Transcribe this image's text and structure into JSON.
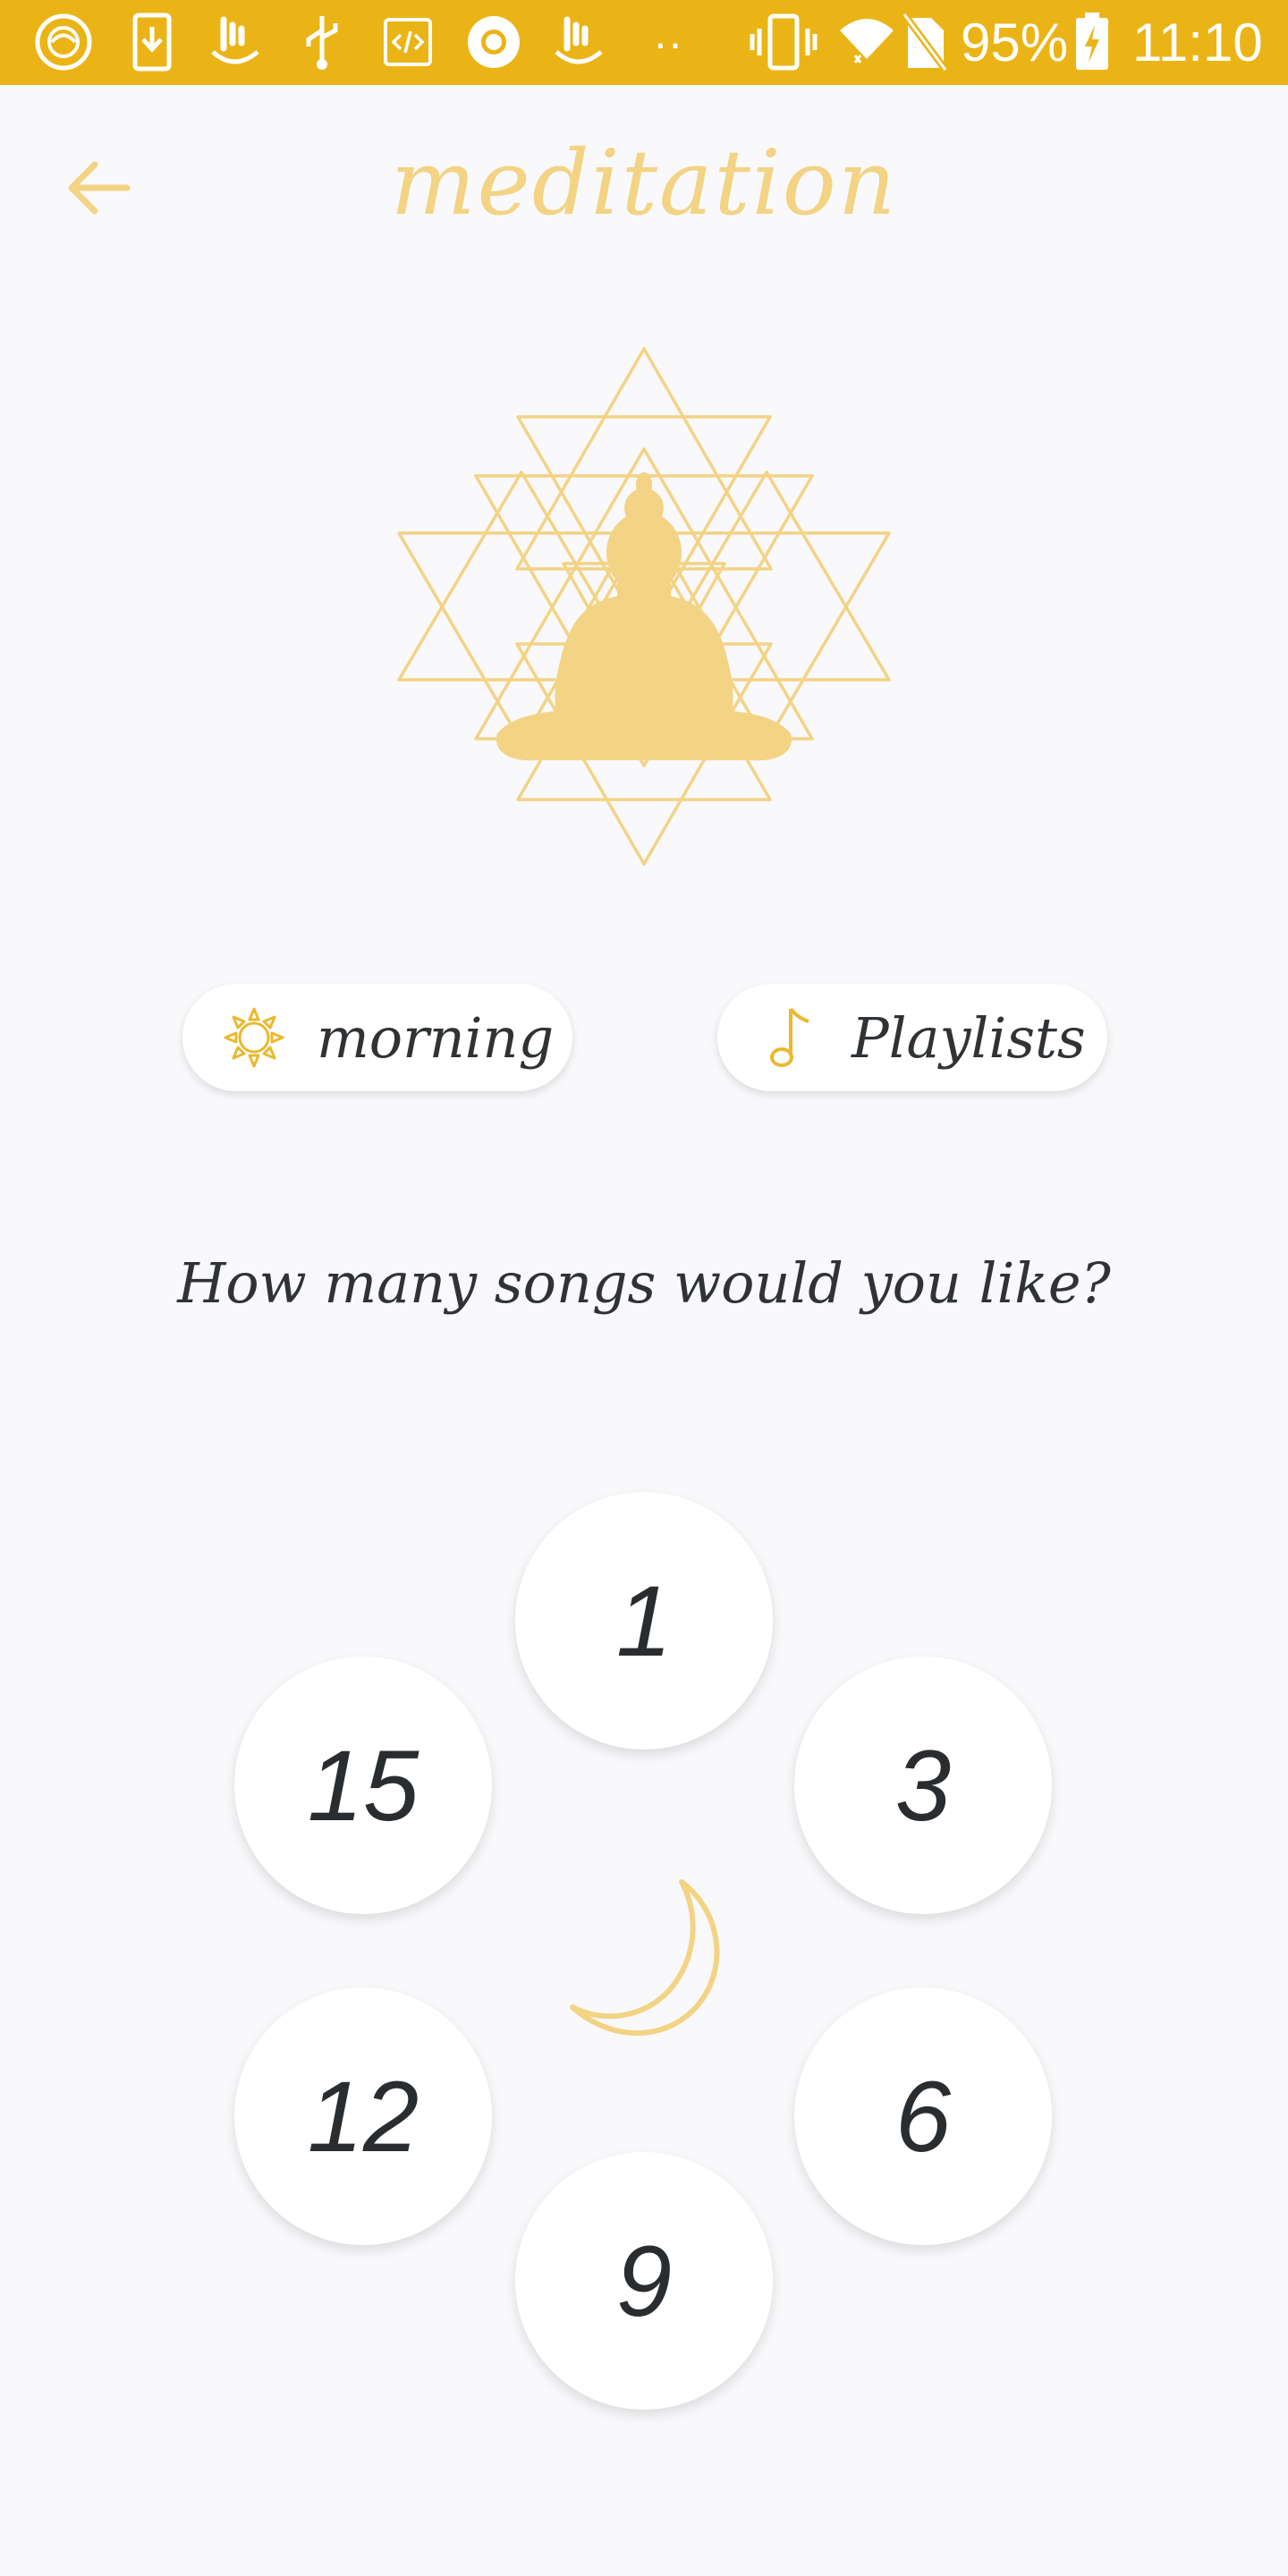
{
  "status_bar": {
    "battery_percent": "95%",
    "time": "11:10",
    "overflow_dots": "··",
    "icons": [
      "app-notification-icon",
      "download-icon",
      "hand-icon",
      "usb-icon",
      "code-icon",
      "record-icon",
      "hand-icon",
      "vibrate-icon",
      "wifi-icon",
      "no-sim-icon",
      "battery-charging-icon"
    ],
    "background_color": "#ebb416"
  },
  "header": {
    "title": "meditation",
    "back_icon": "arrow-left-icon",
    "accent_color": "#f3d384"
  },
  "hero": {
    "icon": "buddha-sri-yantra-icon"
  },
  "pills": {
    "time_of_day": {
      "label": "morning",
      "icon": "sun-icon"
    },
    "playlists": {
      "label": "Playlists",
      "icon": "music-note-icon"
    }
  },
  "question": "How many songs would you like?",
  "song_counts": [
    "1",
    "3",
    "6",
    "9",
    "12",
    "15"
  ],
  "center_icon": "moon-icon"
}
